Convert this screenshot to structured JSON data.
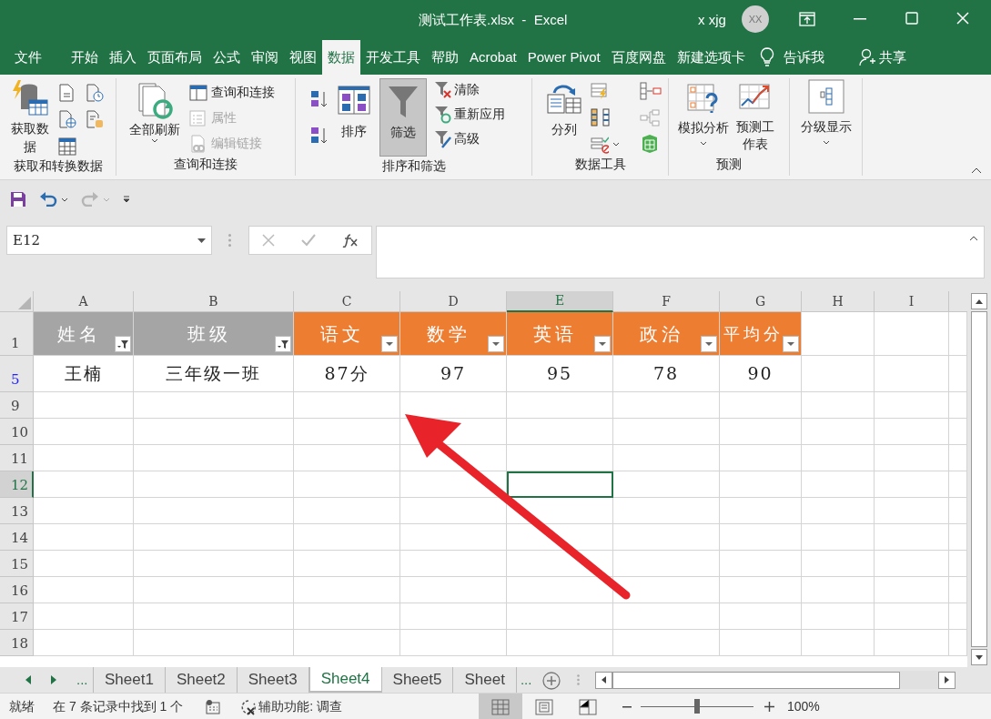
{
  "title_bar": {
    "title": "测试工作表.xlsx  -  Excel",
    "user": "x xjg",
    "avatar": "XX"
  },
  "ribbon_tabs": [
    {
      "label": "文件",
      "selected": false
    },
    {
      "label": "开始",
      "selected": false
    },
    {
      "label": "插入",
      "selected": false
    },
    {
      "label": "页面布局",
      "selected": false
    },
    {
      "label": "公式",
      "selected": false
    },
    {
      "label": "审阅",
      "selected": false
    },
    {
      "label": "视图",
      "selected": false
    },
    {
      "label": "数据",
      "selected": true
    },
    {
      "label": "开发工具",
      "selected": false
    },
    {
      "label": "帮助",
      "selected": false
    },
    {
      "label": "Acrobat",
      "selected": false
    },
    {
      "label": "Power Pivot",
      "selected": false
    },
    {
      "label": "百度网盘",
      "selected": false
    },
    {
      "label": "新建选项卡",
      "selected": false
    }
  ],
  "tell_me": "告诉我",
  "share": "共享",
  "ribbon_groups": [
    {
      "label": "获取和转换数据",
      "items": [
        {
          "label": "获取数据",
          "disabled": false,
          "pressed": false
        }
      ]
    },
    {
      "label": "查询和连接",
      "items": [
        {
          "label": "全部刷新",
          "disabled": false,
          "pressed": false
        },
        {
          "label": "查询和连接",
          "disabled": false,
          "pressed": false
        },
        {
          "label": "属性",
          "disabled": true,
          "pressed": false
        },
        {
          "label": "编辑链接",
          "disabled": true,
          "pressed": false
        }
      ]
    },
    {
      "label": "排序和筛选",
      "items": [
        {
          "label": "排序",
          "disabled": false,
          "pressed": false
        },
        {
          "label": "筛选",
          "disabled": false,
          "pressed": true
        },
        {
          "label": "清除",
          "disabled": false,
          "pressed": false
        },
        {
          "label": "重新应用",
          "disabled": false,
          "pressed": false
        },
        {
          "label": "高级",
          "disabled": false,
          "pressed": false
        }
      ]
    },
    {
      "label": "数据工具",
      "items": [
        {
          "label": "分列",
          "disabled": false,
          "pressed": false
        }
      ]
    },
    {
      "label": "预测",
      "items": [
        {
          "label": "模拟分析",
          "disabled": false,
          "pressed": false
        },
        {
          "label": "预测工作表",
          "disabled": false,
          "pressed": false
        }
      ]
    },
    {
      "items": [
        {
          "label": "分级显示",
          "disabled": false,
          "pressed": false
        }
      ]
    }
  ],
  "name_box": "E12",
  "columns": [
    {
      "label": "A",
      "selected": false
    },
    {
      "label": "B",
      "selected": false
    },
    {
      "label": "C",
      "selected": false
    },
    {
      "label": "D",
      "selected": false
    },
    {
      "label": "E",
      "selected": true
    },
    {
      "label": "F",
      "selected": false
    },
    {
      "label": "G",
      "selected": false
    },
    {
      "label": "H",
      "selected": false
    },
    {
      "label": "I",
      "selected": false
    }
  ],
  "rows": [
    {
      "label": "1",
      "selected": false,
      "filtered": false
    },
    {
      "label": "5",
      "selected": false,
      "filtered": true
    },
    {
      "label": "9",
      "selected": false,
      "filtered": false
    },
    {
      "label": "10",
      "selected": false,
      "filtered": false
    },
    {
      "label": "11",
      "selected": false,
      "filtered": false
    },
    {
      "label": "12",
      "selected": true,
      "filtered": false
    },
    {
      "label": "13",
      "selected": false,
      "filtered": false
    },
    {
      "label": "14",
      "selected": false,
      "filtered": false
    },
    {
      "label": "15",
      "selected": false,
      "filtered": false
    },
    {
      "label": "16",
      "selected": false,
      "filtered": false
    },
    {
      "label": "17",
      "selected": false,
      "filtered": false
    },
    {
      "label": "18",
      "selected": false,
      "filtered": false
    }
  ],
  "header_cells": [
    {
      "text": "姓名",
      "color": "#a5a5a5",
      "filtered": true
    },
    {
      "text": "班级",
      "color": "#a5a5a5",
      "filtered": true
    },
    {
      "text": "语文",
      "color": "#ed7d31",
      "filtered": false
    },
    {
      "text": "数学",
      "color": "#ed7d31",
      "filtered": false
    },
    {
      "text": "英语",
      "color": "#ed7d31",
      "filtered": false
    },
    {
      "text": "政治",
      "color": "#ed7d31",
      "filtered": false
    },
    {
      "text": "平均分",
      "color": "#ed7d31",
      "filtered": false
    }
  ],
  "data_row": [
    "王楠",
    "三年级一班",
    "87分",
    "97",
    "95",
    "78",
    "90"
  ],
  "sheet_nav_more": "...",
  "sheets": [
    {
      "label": "Sheet1",
      "selected": false
    },
    {
      "label": "Sheet2",
      "selected": false
    },
    {
      "label": "Sheet3",
      "selected": false
    },
    {
      "label": "Sheet4",
      "selected": true
    },
    {
      "label": "Sheet5",
      "selected": false
    },
    {
      "label": "Sheet",
      "selected": false
    }
  ],
  "sheets_more": "...",
  "status": {
    "ready": "就绪",
    "message": "在 7 条记录中找到 1 个",
    "accessibility": "辅助功能: 调查",
    "zoom": "100%",
    "zoom_slider": {
      "level": 0.5
    }
  },
  "view_buttons": [
    {
      "selected": true
    },
    {
      "selected": false
    },
    {
      "selected": false
    }
  ]
}
